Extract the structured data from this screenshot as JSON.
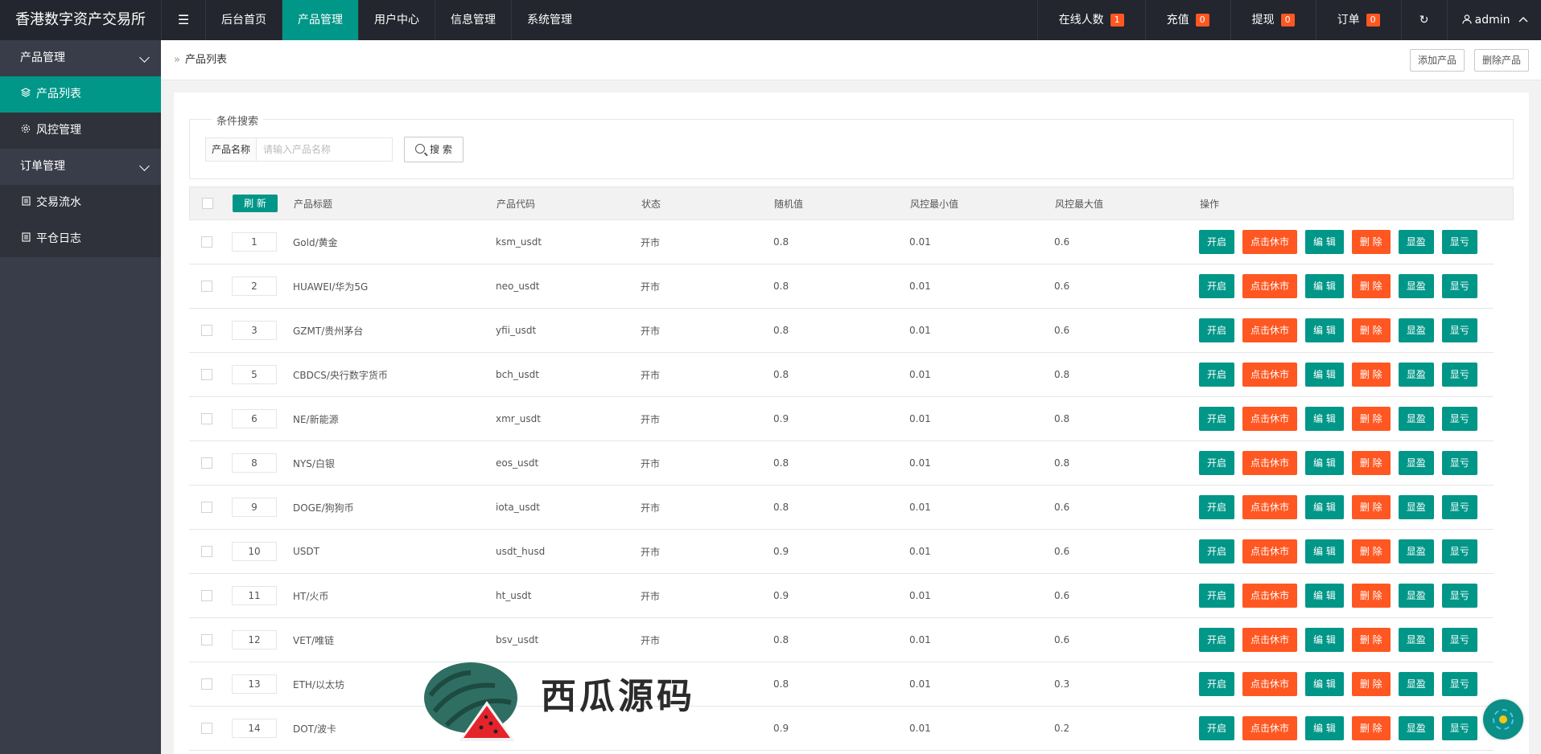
{
  "brand": "香港数字资产交易所",
  "topnav": {
    "toggle_icon": "☰",
    "items": [
      {
        "label": "后台首页",
        "active": false
      },
      {
        "label": "产品管理",
        "active": true
      },
      {
        "label": "用户中心",
        "active": false
      },
      {
        "label": "信息管理",
        "active": false
      },
      {
        "label": "系统管理",
        "active": false
      }
    ]
  },
  "topright": {
    "online": {
      "label": "在线人数",
      "count": "1"
    },
    "recharge": {
      "label": "充值",
      "count": "0"
    },
    "withdraw": {
      "label": "提现",
      "count": "0"
    },
    "orders": {
      "label": "订单",
      "count": "0"
    },
    "refresh_icon": "↻",
    "user": "admin"
  },
  "sidebar": {
    "groups": [
      {
        "label": "产品管理",
        "items": [
          {
            "label": "产品列表",
            "icon": "layers-icon",
            "active": true
          },
          {
            "label": "风控管理",
            "icon": "gear-icon",
            "active": false
          }
        ]
      },
      {
        "label": "订单管理",
        "items": [
          {
            "label": "交易流水",
            "icon": "document-icon",
            "active": false
          },
          {
            "label": "平仓日志",
            "icon": "document-icon",
            "active": false
          }
        ]
      }
    ]
  },
  "breadcrumb": {
    "current": "产品列表"
  },
  "actions": {
    "add": "添加产品",
    "delete": "删除产品"
  },
  "search": {
    "legend": "条件搜索",
    "label": "产品名称",
    "placeholder": "请输入产品名称",
    "button": "搜 索"
  },
  "table": {
    "headers": {
      "refresh": "刷 新",
      "title": "产品标题",
      "code": "产品代码",
      "status": "状态",
      "random": "随机值",
      "risk_min": "风控最小值",
      "risk_max": "风控最大值",
      "ops": "操作"
    },
    "op_labels": {
      "open": "开启",
      "close": "点击休市",
      "edit": "编 辑",
      "delete": "删 除",
      "profit": "显盈",
      "loss": "显亏"
    },
    "rows": [
      {
        "sort": "1",
        "title": "Gold/黄金",
        "code": "ksm_usdt",
        "status": "开市",
        "random": "0.8",
        "min": "0.01",
        "max": "0.6"
      },
      {
        "sort": "2",
        "title": "HUAWEI/华为5G",
        "code": "neo_usdt",
        "status": "开市",
        "random": "0.8",
        "min": "0.01",
        "max": "0.6"
      },
      {
        "sort": "3",
        "title": "GZMT/贵州茅台",
        "code": "yfii_usdt",
        "status": "开市",
        "random": "0.8",
        "min": "0.01",
        "max": "0.6"
      },
      {
        "sort": "5",
        "title": "CBDCS/央行数字货币",
        "code": "bch_usdt",
        "status": "开市",
        "random": "0.8",
        "min": "0.01",
        "max": "0.8"
      },
      {
        "sort": "6",
        "title": "NE/新能源",
        "code": "xmr_usdt",
        "status": "开市",
        "random": "0.9",
        "min": "0.01",
        "max": "0.8"
      },
      {
        "sort": "8",
        "title": "NYS/白银",
        "code": "eos_usdt",
        "status": "开市",
        "random": "0.8",
        "min": "0.01",
        "max": "0.8"
      },
      {
        "sort": "9",
        "title": "DOGE/狗狗币",
        "code": "iota_usdt",
        "status": "开市",
        "random": "0.8",
        "min": "0.01",
        "max": "0.6"
      },
      {
        "sort": "10",
        "title": "USDT",
        "code": "usdt_husd",
        "status": "开市",
        "random": "0.9",
        "min": "0.01",
        "max": "0.6"
      },
      {
        "sort": "11",
        "title": "HT/火币",
        "code": "ht_usdt",
        "status": "开市",
        "random": "0.9",
        "min": "0.01",
        "max": "0.6"
      },
      {
        "sort": "12",
        "title": "VET/唯链",
        "code": "bsv_usdt",
        "status": "开市",
        "random": "0.8",
        "min": "0.01",
        "max": "0.6"
      },
      {
        "sort": "13",
        "title": "ETH/以太坊",
        "code": "",
        "status": "",
        "random": "0.8",
        "min": "0.01",
        "max": "0.3"
      },
      {
        "sort": "14",
        "title": "DOT/波卡",
        "code": "",
        "status": "",
        "random": "0.9",
        "min": "0.01",
        "max": "0.2"
      }
    ]
  },
  "watermark": {
    "text": "西瓜源码"
  },
  "colors": {
    "accent": "#009688",
    "warn": "#ff5722",
    "topbar": "#23262e",
    "sidebar": "#393d49"
  }
}
